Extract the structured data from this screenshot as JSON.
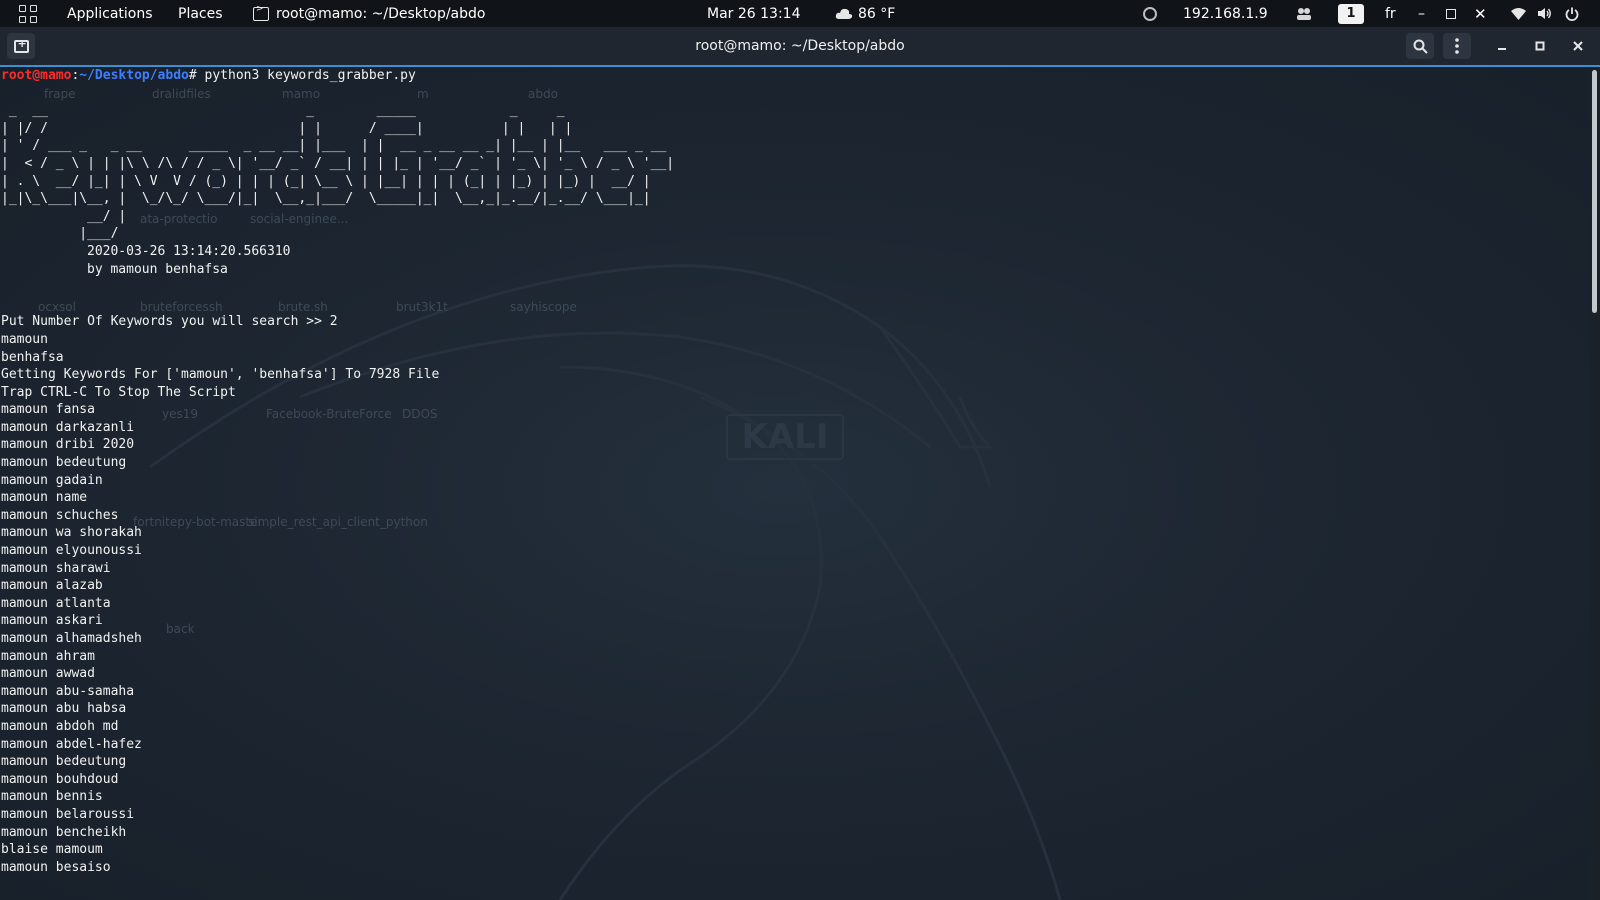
{
  "topbar": {
    "apps_icon": "grid-icon",
    "applications": "Applications",
    "places": "Places",
    "active_window": "root@mamo: ~/Desktop/abdo",
    "datetime": "Mar 26  13:14",
    "weather": "86 °F",
    "ip": "192.168.1.9",
    "workspace": "1",
    "keyboard": "fr"
  },
  "window": {
    "title": "root@mamo: ~/Desktop/abdo"
  },
  "terminal": {
    "prompt_user": "root@mamo",
    "prompt_path": "~/Desktop/abdo",
    "prompt_suffix": "#",
    "command": " python3 keywords_grabber.py",
    "banner": [
      " _  __                                 _        _____            _     _",
      "| |/ /                                | |      / ____|          | |   | |",
      "| ' / ___ _   _ __      _____  _ __ __| |___  | |  __ _ __ __ _| |__ | |__   ___ _ __",
      "|  < / _ \\ | | |\\ \\ /\\ / / _ \\| '__/ _` / __| | | |_ | '__/ _` | '_ \\| '_ \\ / _ \\ '__|",
      "| . \\  __/ |_| | \\ V  V / (_) | | | (_| \\__ \\ | |__| | | | (_| | |_) | |_) |  __/ |",
      "|_|\\_\\___|\\__, |  \\_/\\_/ \\___/|_|  \\__,_|___/  \\_____|_|  \\__,_|_.__/|_.__/ \\___|_|",
      "           __/ |",
      "          |___/"
    ],
    "timestamp": "2020-03-26 13:14:20.566310",
    "author": "by mamoun benhafsa",
    "output": [
      "Put Number Of Keywords you will search >> 2",
      "mamoun",
      "benhafsa",
      "Getting Keywords For ['mamoun', 'benhafsa'] To 7928 File",
      "Trap CTRL-C To Stop The Script",
      "mamoun fansa",
      "mamoun darkazanli",
      "mamoun dribi 2020",
      "mamoun bedeutung",
      "mamoun gadain",
      "mamoun name",
      "mamoun schuches",
      "mamoun wa shorakah",
      "mamoun elyounoussi",
      "mamoun sharawi",
      "mamoun alazab",
      "mamoun atlanta",
      "mamoun askari",
      "mamoun alhamadsheh",
      "mamoun ahram",
      "mamoun awwad",
      "mamoun abu-samaha",
      "mamoun abu habsa",
      "mamoun abdoh md",
      "mamoun abdel-hafez",
      "mamoun bedeutung",
      "mamoun bouhdoud",
      "mamoun bennis",
      "mamoun belaroussi",
      "mamoun bencheikh",
      "blaise mamoum",
      "mamoun besaiso"
    ]
  },
  "wallpaper": {
    "watermark": "KALI",
    "desktop_icons": [
      "frape",
      "dralidfiles",
      "mamo",
      "m",
      "abdo",
      "ata-protectio",
      "social-enginee...",
      "ocxsol",
      "bruteforcessh",
      "brute.sh",
      "brut3k1t",
      "sayhiscope",
      "yes19",
      "Facebook-BruteForce",
      "DDOS",
      "fortnitepy-bot-master",
      "simple_rest_api_client_python",
      "back"
    ]
  },
  "colors": {
    "prompt_user": "#ff2b2b",
    "prompt_path": "#3d7eff",
    "accent": "#3a8fd6",
    "terminal_bg": "#1d2631"
  }
}
